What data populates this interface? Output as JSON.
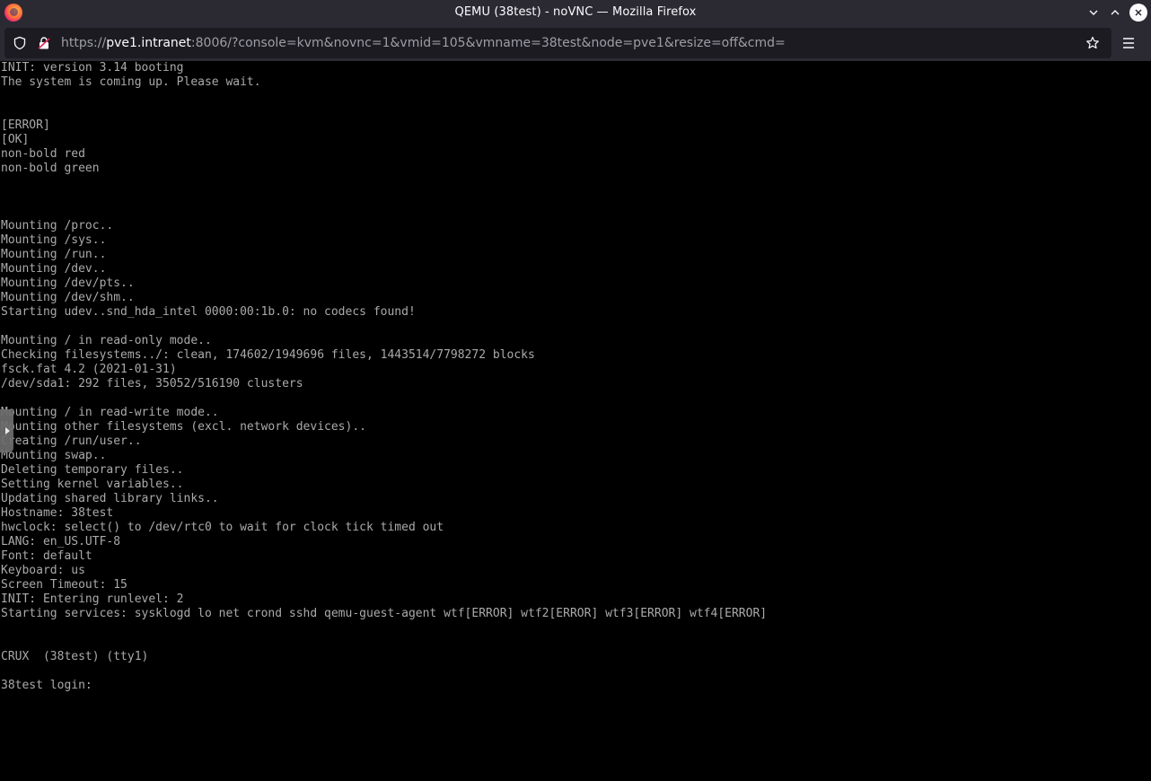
{
  "window": {
    "title": "QEMU (38test) - noVNC — Mozilla Firefox"
  },
  "urlbar": {
    "url_prefix": "https://",
    "url_host": "pve1.intranet",
    "url_rest": ":8006/?console=kvm&novnc=1&vmid=105&vmname=38test&node=pve1&resize=off&cmd="
  },
  "console": {
    "lines": [
      "INIT: version 3.14 booting",
      "The system is coming up. Please wait.",
      "",
      "",
      "[ERROR]",
      "[OK]",
      "non-bold red",
      "non-bold green",
      "",
      "",
      "",
      "Mounting /proc..",
      "Mounting /sys..",
      "Mounting /run..",
      "Mounting /dev..",
      "Mounting /dev/pts..",
      "Mounting /dev/shm..",
      "Starting udev..snd_hda_intel 0000:00:1b.0: no codecs found!",
      "",
      "Mounting / in read-only mode..",
      "Checking filesystems../: clean, 174602/1949696 files, 1443514/7798272 blocks",
      "fsck.fat 4.2 (2021-01-31)",
      "/dev/sda1: 292 files, 35052/516190 clusters",
      "",
      "Mounting / in read-write mode..",
      "Mounting other filesystems (excl. network devices)..",
      "Creating /run/user..",
      "Mounting swap..",
      "Deleting temporary files..",
      "Setting kernel variables..",
      "Updating shared library links..",
      "Hostname: 38test",
      "hwclock: select() to /dev/rtc0 to wait for clock tick timed out",
      "LANG: en_US.UTF-8",
      "Font: default",
      "Keyboard: us",
      "Screen Timeout: 15",
      "INIT: Entering runlevel: 2",
      "Starting services: sysklogd lo net crond sshd qemu-guest-agent wtf[ERROR] wtf2[ERROR] wtf3[ERROR] wtf4[ERROR]",
      "",
      "",
      "CRUX  (38test) (tty1)",
      "",
      "38test login: "
    ]
  },
  "colors": {
    "chrome_bg": "#2b2a33",
    "url_field_bg": "#1c1b22",
    "console_bg": "#000000",
    "console_fg": "#aaaaaa"
  }
}
